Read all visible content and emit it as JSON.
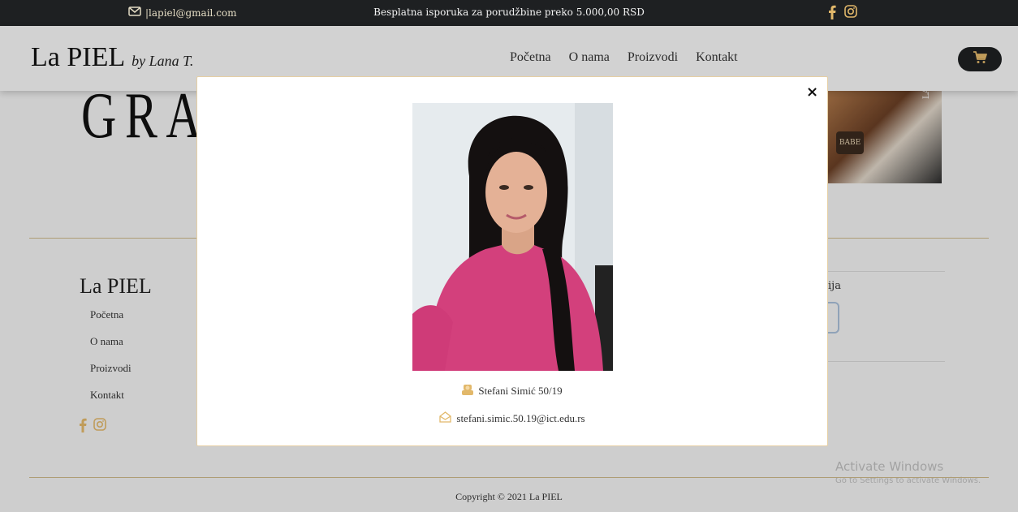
{
  "topbar": {
    "email": "|lapiel@gmail.com",
    "shipping_notice": "Besplatna isporuka za porudžbine preko 5.000,00 RSD",
    "social_icons": [
      "facebook-icon",
      "instagram-icon"
    ]
  },
  "header": {
    "logo": "La PIEL",
    "logo_signature": "by Lana T.",
    "nav": [
      "Početna",
      "O nama",
      "Proizvodi",
      "Kontakt"
    ],
    "cart_icon": "shopping-cart-icon"
  },
  "page": {
    "hero_text": "GRA",
    "hero_photo_badge": "BABE",
    "hero_photo_side": "LAZENKA",
    "footer_brand": "La PIEL",
    "footer_links": [
      "Početna",
      "O nama",
      "Proizvodi",
      "Kontakt"
    ],
    "right_col_text": "ija",
    "copyright": "Copyright © 2021 La PIEL"
  },
  "modal": {
    "close_label": "×",
    "author_name": "Stefani Simić 50/19",
    "author_email": "stefani.simic.50.19@ict.edu.rs"
  },
  "watermark": {
    "title": "Activate Windows",
    "subtitle": "Go to Settings to activate Windows."
  },
  "colors": {
    "dark": "#1e2022",
    "gold": "#e2b86a",
    "gold_line": "#cdb98a",
    "pink_shirt": "#d3407c"
  }
}
